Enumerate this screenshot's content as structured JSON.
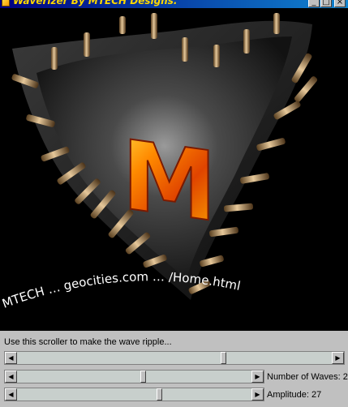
{
  "window": {
    "title": "Waverizer By MTECH Designs.",
    "controls": {
      "minimize": "_",
      "maximize": "□",
      "close": "×"
    }
  },
  "artwork": {
    "logo_letter": "M",
    "curved_text": "MTECH … geocities.com … /Home.html"
  },
  "controls": {
    "instruction": "Use this scroller to make the wave ripple...",
    "scroll_left_icon": "◀",
    "scroll_right_icon": "▶",
    "ripple_scroller": {
      "position": 0.66
    },
    "waves_scroller": {
      "label": "Number of Waves: 2",
      "position": 0.54
    },
    "amplitude_scroller": {
      "label": "Amplitude: 27",
      "position": 0.61
    }
  }
}
